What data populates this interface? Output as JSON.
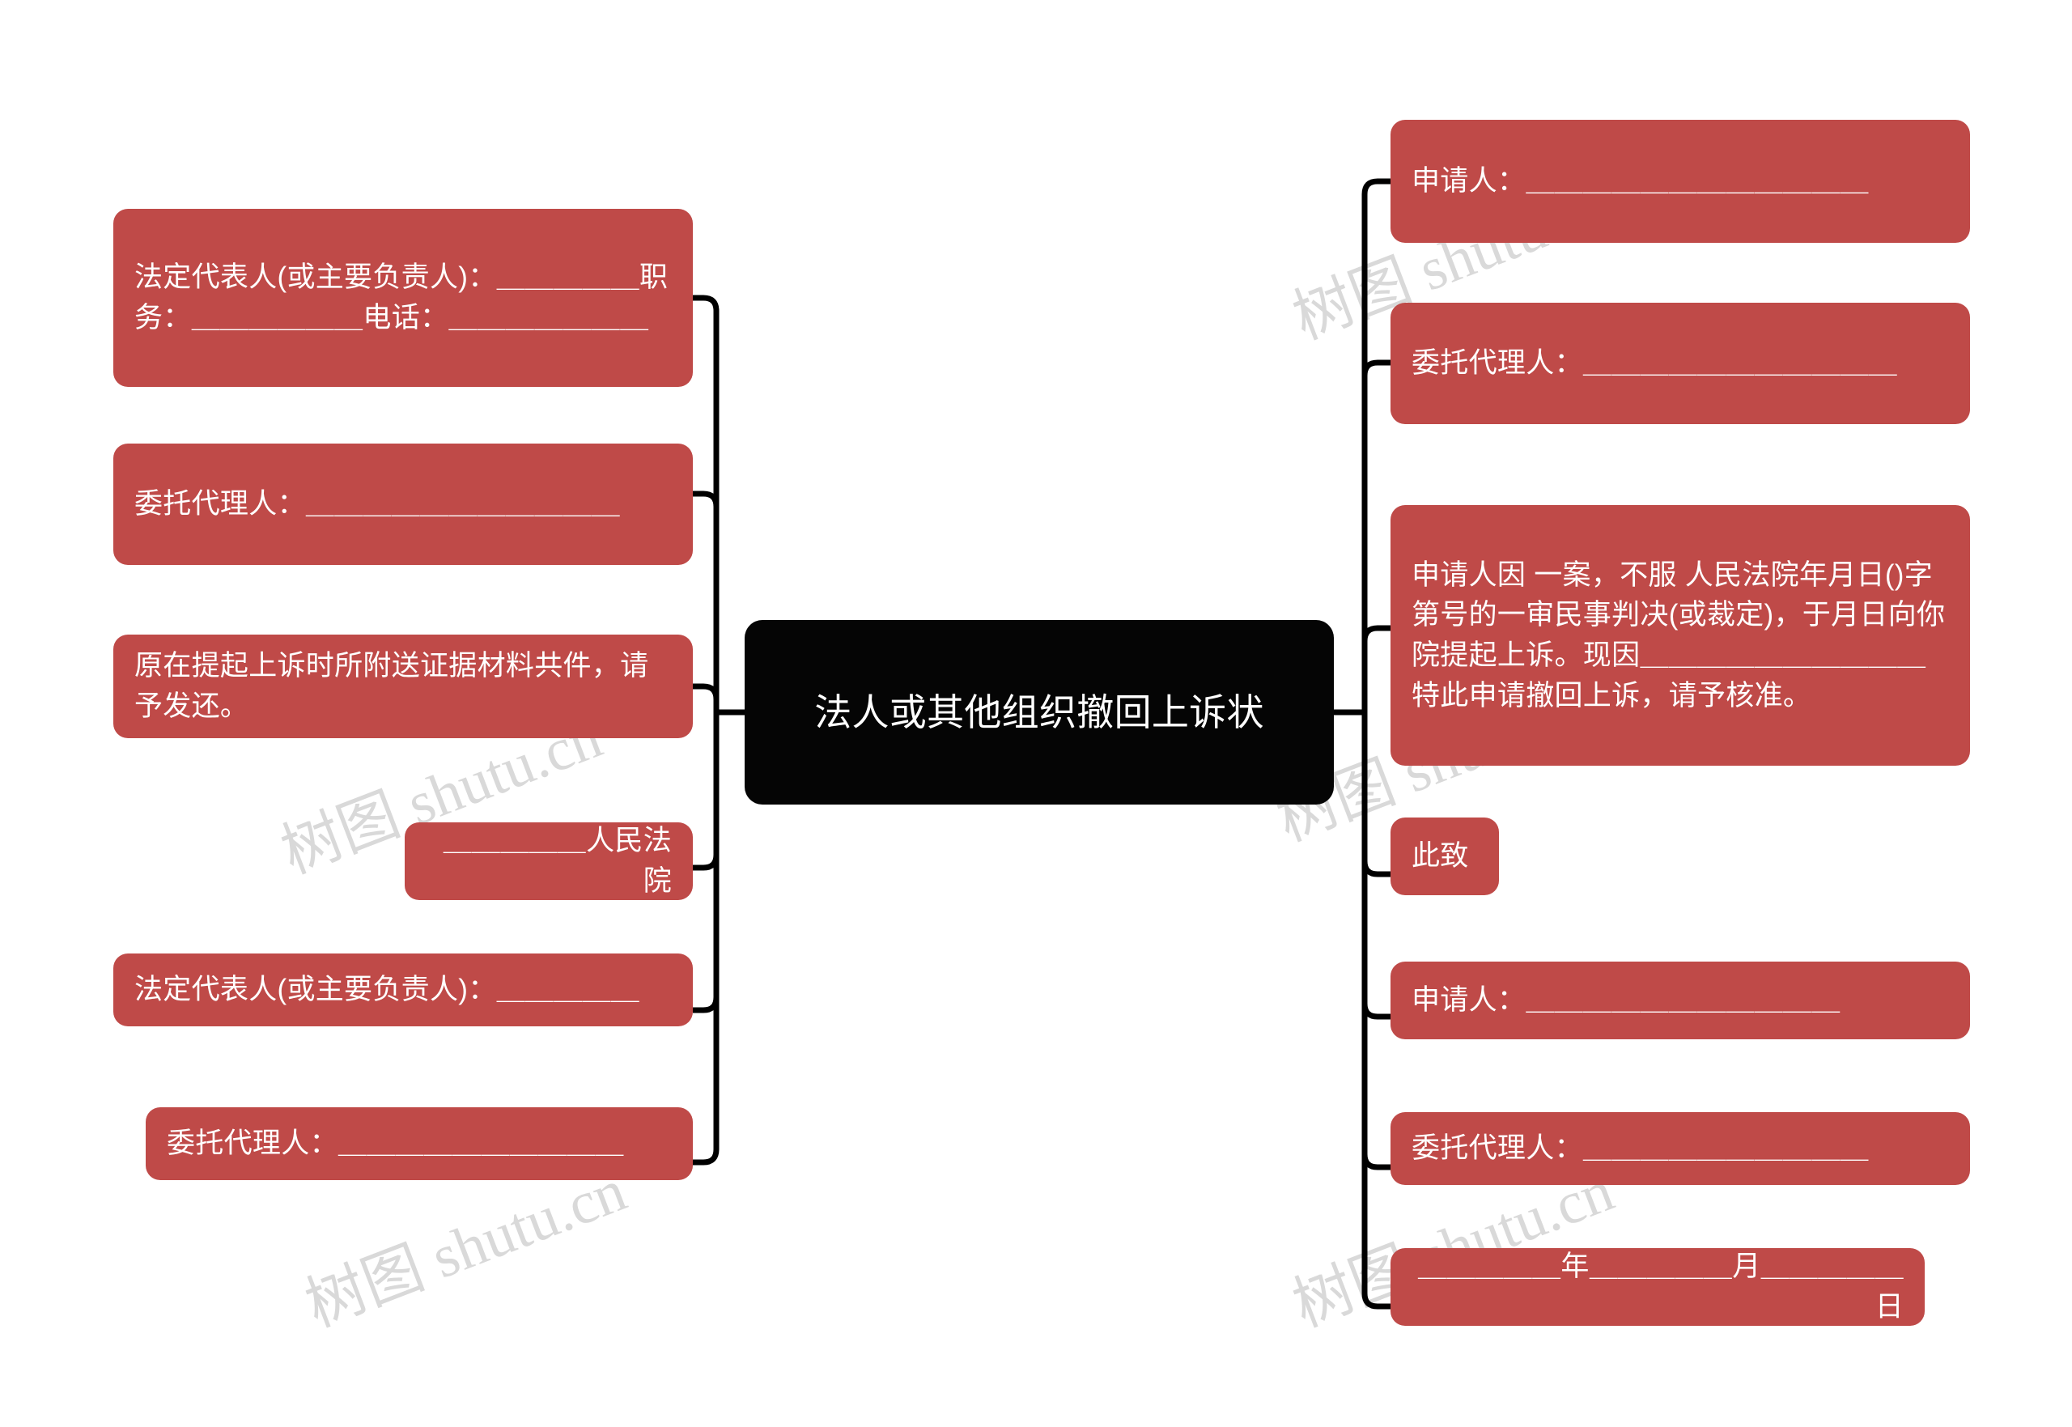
{
  "diagram": {
    "type": "mindmap",
    "title": "法人或其他组织撤回上诉状",
    "watermark": "树图 shutu.cn",
    "colors": {
      "node_fill": "#bf4a48",
      "root_fill": "#050505",
      "node_text": "#ffffff",
      "connector": "#000000",
      "background": "#ffffff",
      "watermark": "#d9d9d9"
    },
    "root": {
      "label": "法人或其他组织撤回上诉状"
    },
    "left_branch": [
      {
        "id": "l1",
        "label": "法定代表人(或主要负责人)：＿＿＿＿＿职务：＿＿＿＿＿＿电话：＿＿＿＿＿＿＿"
      },
      {
        "id": "l2",
        "label": "委托代理人：＿＿＿＿＿＿＿＿＿＿＿"
      },
      {
        "id": "l3",
        "label": "原在提起上诉时所附送证据材料共件，请予发还。"
      },
      {
        "id": "l4",
        "label": "＿＿＿＿＿人民法院"
      },
      {
        "id": "l5",
        "label": "法定代表人(或主要负责人)：＿＿＿＿＿"
      },
      {
        "id": "l6",
        "label": "委托代理人：＿＿＿＿＿＿＿＿＿＿"
      }
    ],
    "right_branch": [
      {
        "id": "r1",
        "label": "申请人：＿＿＿＿＿＿＿＿＿＿＿＿"
      },
      {
        "id": "r2",
        "label": "委托代理人：＿＿＿＿＿＿＿＿＿＿＿"
      },
      {
        "id": "r3",
        "label": "申请人因 一案，不服 人民法院年月日()字第号的一审民事判决(或裁定)，于月日向你院提起上诉。现因＿＿＿＿＿＿＿＿＿＿特此申请撤回上诉，请予核准。"
      },
      {
        "id": "r4",
        "label": "此致"
      },
      {
        "id": "r5",
        "label": "申请人：＿＿＿＿＿＿＿＿＿＿＿"
      },
      {
        "id": "r6",
        "label": "委托代理人：＿＿＿＿＿＿＿＿＿＿"
      },
      {
        "id": "r7",
        "label": "＿＿＿＿＿年＿＿＿＿＿月＿＿＿＿＿日"
      }
    ]
  }
}
